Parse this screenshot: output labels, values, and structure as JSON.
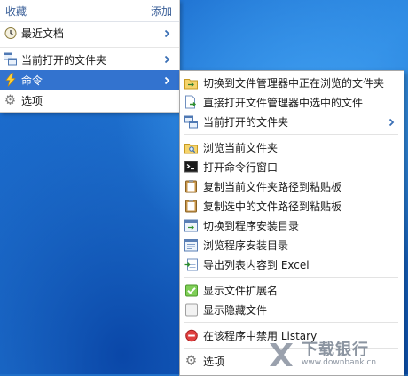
{
  "main_menu": {
    "header_title": "收藏",
    "header_action": "添加",
    "items": [
      {
        "label": "最近文档",
        "icon": "clock-icon"
      },
      {
        "label": "当前打开的文件夹",
        "icon": "windows-icon"
      },
      {
        "label": "命令",
        "icon": "lightning-icon"
      },
      {
        "label": "选项",
        "icon": "gear-icon"
      }
    ]
  },
  "submenu": {
    "items": [
      {
        "label": "切换到文件管理器中正在浏览的文件夹",
        "icon": "folder-switch-icon"
      },
      {
        "label": "直接打开文件管理器中选中的文件",
        "icon": "open-file-icon"
      },
      {
        "label": "当前打开的文件夹",
        "icon": "windows-icon"
      },
      {
        "label": "浏览当前文件夹",
        "icon": "folder-search-icon"
      },
      {
        "label": "打开命令行窗口",
        "icon": "terminal-icon"
      },
      {
        "label": "复制当前文件夹路径到粘贴板",
        "icon": "clipboard-icon"
      },
      {
        "label": "复制选中的文件路径到粘贴板",
        "icon": "clipboard-icon"
      },
      {
        "label": "切换到程序安装目录",
        "icon": "program-folder-icon"
      },
      {
        "label": "浏览程序安装目录",
        "icon": "browse-program-icon"
      },
      {
        "label": "导出列表内容到 Excel",
        "icon": "export-excel-icon"
      },
      {
        "label": "显示文件扩展名",
        "icon": "checkbox-checked-icon"
      },
      {
        "label": "显示隐藏文件",
        "icon": "checkbox-empty-icon"
      },
      {
        "label": "在该程序中禁用 Listary",
        "icon": "disable-icon"
      },
      {
        "label": "选项",
        "icon": "gear-icon"
      }
    ]
  },
  "watermark": {
    "name": "下载银行",
    "url": "www.downbank.cn"
  },
  "colors": {
    "highlight": "#3373cf",
    "header_text": "#3a5f98"
  }
}
